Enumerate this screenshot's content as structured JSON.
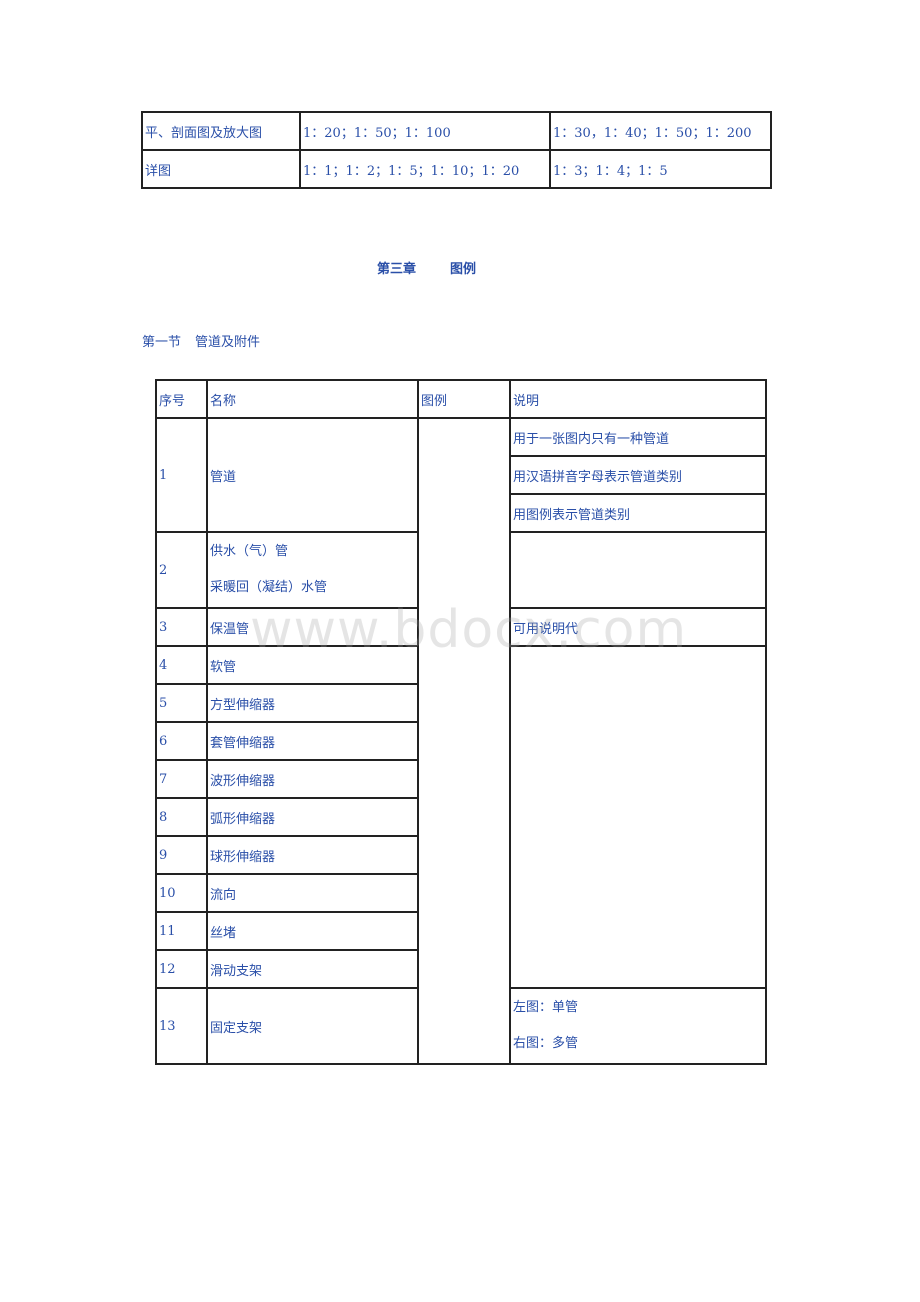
{
  "scale_table": {
    "rows": [
      {
        "label": "平、剖面图及放大图",
        "preferred": "1：20；1：50；1：100",
        "optional": "1：30，1：40；1：50；1：200"
      },
      {
        "label": "详图",
        "preferred": "1：1；1：2；1：5；1：10；1：20",
        "optional": "1：3；1：4；1：5"
      }
    ]
  },
  "chapter": {
    "number": "第三章",
    "title": "图例"
  },
  "section": {
    "number": "第一节",
    "title": "管道及附件"
  },
  "legend_table": {
    "headers": {
      "index": "序号",
      "name": "名称",
      "legend": "图例",
      "note": "说明"
    },
    "rows": [
      {
        "index": "1",
        "name": "管道",
        "notes": [
          "用于一张图内只有一种管道",
          "用汉语拼音字母表示管道类别",
          "用图例表示管道类别"
        ]
      },
      {
        "index": "2",
        "name_lines": [
          "供水（气）管",
          "采暖回（凝结）水管"
        ]
      },
      {
        "index": "3",
        "name": "保温管",
        "note": "可用说明代"
      },
      {
        "index": "4",
        "name": "软管"
      },
      {
        "index": "5",
        "name": "方型伸缩器"
      },
      {
        "index": "6",
        "name": "套管伸缩器"
      },
      {
        "index": "7",
        "name": "波形伸缩器"
      },
      {
        "index": "8",
        "name": "弧形伸缩器"
      },
      {
        "index": "9",
        "name": "球形伸缩器"
      },
      {
        "index": "10",
        "name": "流向"
      },
      {
        "index": "11",
        "name": "丝堵"
      },
      {
        "index": "12",
        "name": "滑动支架"
      },
      {
        "index": "13",
        "name": "固定支架",
        "note_lines": [
          "左图：单管",
          "右图：多管"
        ]
      }
    ]
  },
  "watermark": "www.bdocx.com"
}
